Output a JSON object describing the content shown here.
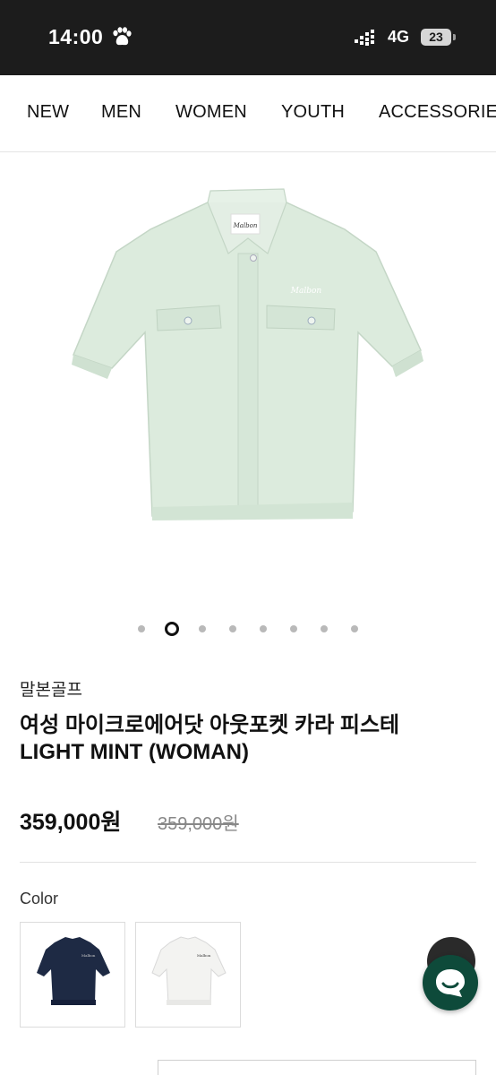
{
  "status_bar": {
    "time": "14:00",
    "network": "4G",
    "battery": "23"
  },
  "nav": {
    "items": [
      "NEW",
      "MEN",
      "WOMEN",
      "YOUTH",
      "ACCESSORIE"
    ]
  },
  "product": {
    "brand": "말본골프",
    "title_ko": "여성 마이크로에어닷 아웃포켓 카라 피스테",
    "title_en": "LIGHT MINT (WOMAN)",
    "price": "359,000원",
    "original_price": "359,000원",
    "image_color": "#dcebdd",
    "chest_logo": "Malbon"
  },
  "carousel": {
    "total": 8,
    "current": 2
  },
  "options": {
    "color_label": "Color",
    "swatches": [
      {
        "name": "navy",
        "color": "#1e2a44"
      },
      {
        "name": "white",
        "color": "#f3f3f1"
      }
    ]
  },
  "colors": {
    "chat": "#0e4a3a",
    "status_bg": "#1c1c1c"
  }
}
